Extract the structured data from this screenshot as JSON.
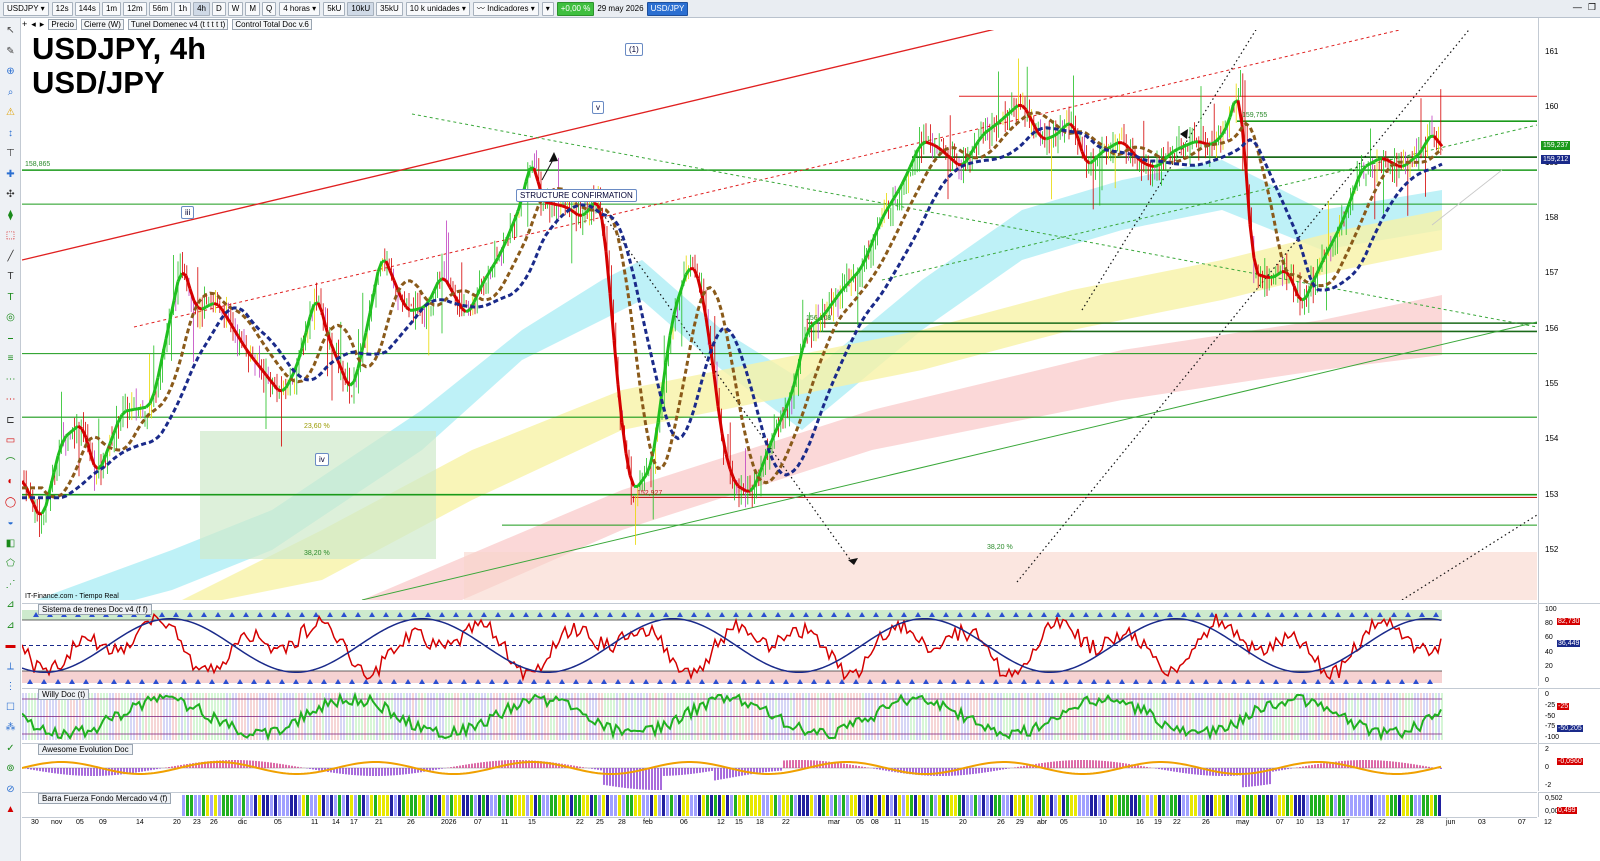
{
  "toolbar": {
    "symbol": "USDJPY",
    "timeframes": [
      "12s",
      "144s",
      "1m",
      "12m",
      "56m",
      "1h",
      "4h",
      "D",
      "W",
      "M",
      "Q"
    ],
    "active_timeframe": "4h",
    "interval": "4 horas",
    "volumes": [
      "5kU",
      "10kU",
      "35kU"
    ],
    "units": "10 k unidades",
    "indicators_label": "Indicadores",
    "change": "+0,00 %",
    "date": "29 may 2026",
    "pair_badge": "USD/JPY"
  },
  "legend": [
    "Precio",
    "Cierre (W)",
    "Tunel Domenec v4 (t t t t t)",
    "Control Total Doc v.6"
  ],
  "chart_title": "USDJPY, 4h",
  "chart_subtitle": "USD/JPY",
  "source": "IT-Finance.com - Tiempo Real",
  "annotations": {
    "wave1": "(1)",
    "wave_v": "v",
    "wave_iii": "iii",
    "wave_iv": "iv",
    "structure": "STRUCTURE CONFIRMATION"
  },
  "price_labels": {
    "p158865": "158,865",
    "p159755": "159,755",
    "p156108": "156,108",
    "p152927": "152,927",
    "fib_2360": "23,60 %",
    "fib_3820a": "38,20 %",
    "fib_3820b": "38,20 %"
  },
  "price_axis": [
    "161",
    "160",
    "159",
    "158",
    "157",
    "156",
    "155",
    "154",
    "153",
    "152"
  ],
  "price_tags": {
    "last1": "159,237",
    "last2": "159,212"
  },
  "panels": {
    "trend": {
      "label": "Sistema de trenes Doc v4 (f f)",
      "axis": [
        "100",
        "80",
        "60",
        "40",
        "20",
        "0"
      ],
      "tags": [
        "82,730",
        "36,449"
      ]
    },
    "willy": {
      "label": "Willy Doc (t)",
      "axis": [
        "0",
        "-25",
        "-50",
        "-75",
        "-100"
      ],
      "tags": [
        "-25",
        "-50,205"
      ]
    },
    "awesome": {
      "label": "Awesome Evolution Doc",
      "axis": [
        "2",
        "0",
        "-2"
      ],
      "tags": [
        "-0,0960"
      ]
    },
    "barra": {
      "label": "Barra Fuerza Fondo Mercado v4 (f)",
      "axis": [
        "0,502",
        "0,00000"
      ],
      "tags": [
        "0,499"
      ]
    }
  },
  "time_axis": [
    "30",
    "nov",
    "05",
    "09",
    "14",
    "20",
    "23",
    "26",
    "dic",
    "05",
    "11",
    "14",
    "17",
    "21",
    "26",
    "2026",
    "07",
    "11",
    "15",
    "22",
    "25",
    "28",
    "feb",
    "06",
    "12",
    "15",
    "18",
    "22",
    "mar",
    "05",
    "08",
    "11",
    "15",
    "20",
    "26",
    "29",
    "abr",
    "05",
    "10",
    "16",
    "19",
    "22",
    "26",
    "may",
    "07",
    "10",
    "13",
    "17",
    "22",
    "28",
    "jun",
    "03",
    "07",
    "12"
  ],
  "colors": {
    "up": "#1fbf1f",
    "down": "#d40000",
    "ma_blue": "#1a2a8a",
    "ma_brown": "#8a5a1a",
    "band_cyan": "#a8ecf4",
    "band_yellow": "#f7f2a6",
    "band_pink": "#f9c8c8",
    "green_line": "#1a9a1a",
    "red_line": "#e02020"
  }
}
